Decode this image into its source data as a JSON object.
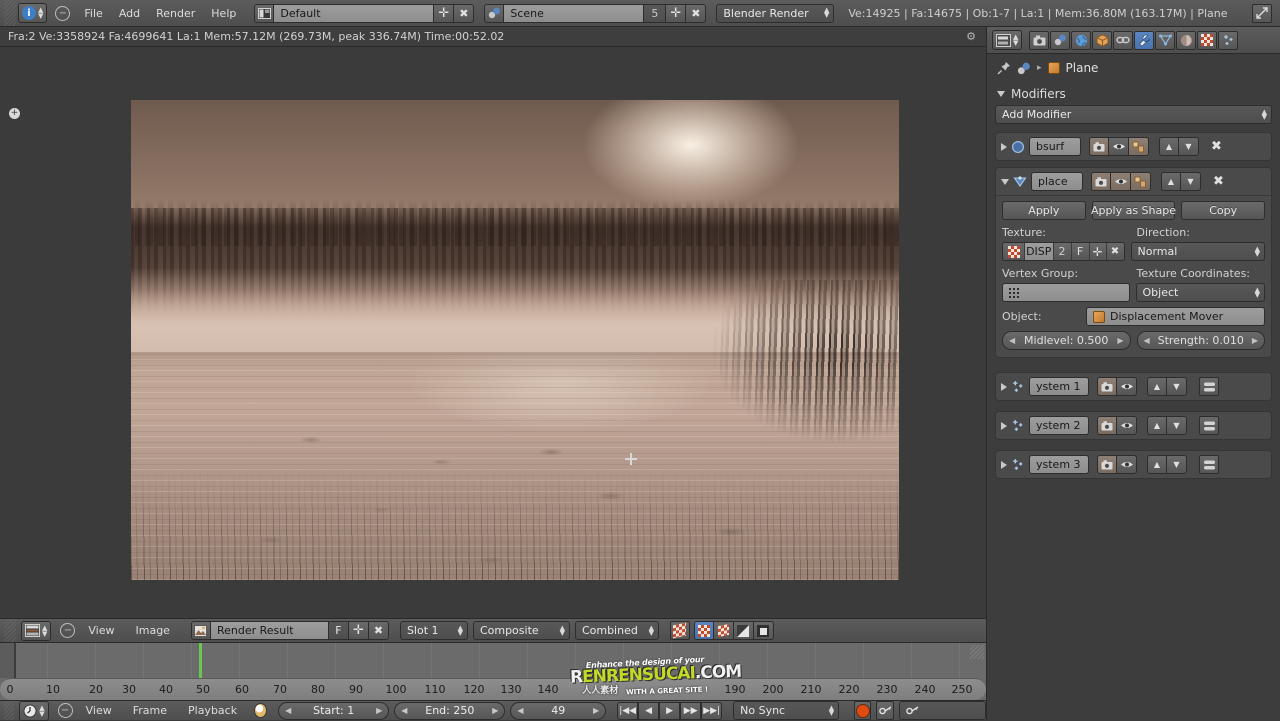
{
  "topbar": {
    "editor_icon": "info-editor-icon",
    "collapse_icon": "minus-icon",
    "menus": [
      "File",
      "Add",
      "Render",
      "Help"
    ],
    "screen_layout": {
      "icon": "screen-layout-icon",
      "value": "Default",
      "add": "+",
      "remove": "✕"
    },
    "scene": {
      "icon": "scene-icon",
      "value": "Scene",
      "users": "5",
      "add": "+",
      "remove": "✕"
    },
    "engine": "Blender Render",
    "stats": "Ve:14925 | Fa:14675 | Ob:1-7 | La:1 | Mem:36.80M (163.17M) | Plane",
    "maximize_icon": "maximize-icon"
  },
  "info_strip": {
    "text": "Fra:2  Ve:3358924 Fa:4699641 La:1 Mem:57.12M (269.73M, peak 336.74M) Time:00:52.02",
    "gear_icon": "gear-icon"
  },
  "image_editor": {
    "plus_icon": "add-region-icon",
    "render_alt": "Render Result — misty lake at sunrise",
    "cursor_icon": "3d-cursor-icon",
    "header": {
      "editor_icon": "image-editor-icon",
      "collapse_icon": "minus-icon",
      "menus": [
        "View",
        "Image"
      ],
      "image_icon": "image-datablock-icon",
      "image_name": "Render Result",
      "fake_user": "F",
      "add": "+",
      "remove": "✕",
      "slot": "Slot 1",
      "layer": "Composite",
      "pass": "Combined",
      "toggles": [
        "paint-icon",
        "alpha-checker-icon",
        "color-swatch-icon",
        "zdepth-icon",
        "alpha-only-icon"
      ]
    }
  },
  "timeline": {
    "playhead_frame": "49",
    "ticks": [
      "0",
      "10",
      "20",
      "30",
      "40",
      "50",
      "60",
      "70",
      "80",
      "90",
      "100",
      "110",
      "120",
      "130",
      "140",
      "190",
      "200",
      "210",
      "220",
      "230",
      "240",
      "250"
    ],
    "tick_positions": [
      10,
      53,
      96,
      129,
      166,
      203,
      242,
      280,
      318,
      356,
      396,
      435,
      474,
      511,
      548,
      735,
      773,
      811,
      849,
      887,
      925,
      962
    ]
  },
  "playbar": {
    "editor_icon": "timeline-editor-icon",
    "collapse_icon": "minus-icon",
    "menus": [
      "View",
      "Frame",
      "Playback"
    ],
    "clock_icon": "auto-keying-icon",
    "start": "Start: 1",
    "end": "End: 250",
    "current_frame": "49",
    "transport": [
      "jump-start-icon",
      "play-reverse-icon",
      "play-icon",
      "fast-forward-icon",
      "jump-end-icon"
    ],
    "sync": "No Sync",
    "record_icon": "record-icon",
    "key1_icon": "key-icon",
    "key2_icon": "key-icon"
  },
  "properties": {
    "tabs": [
      {
        "name": "render-tab",
        "icon": "camera-icon",
        "active": false
      },
      {
        "name": "scene-tab",
        "icon": "scene-icon",
        "active": false
      },
      {
        "name": "world-tab",
        "icon": "world-icon",
        "active": false
      },
      {
        "name": "object-tab",
        "icon": "cube-icon",
        "active": false
      },
      {
        "name": "constraints-tab",
        "icon": "chain-icon",
        "active": false
      },
      {
        "name": "modifiers-tab",
        "icon": "wrench-icon",
        "active": true
      },
      {
        "name": "data-tab",
        "icon": "triangle-mesh-icon",
        "active": false
      },
      {
        "name": "material-tab",
        "icon": "sphere-icon",
        "active": false
      },
      {
        "name": "texture-tab",
        "icon": "checker-icon",
        "active": false
      },
      {
        "name": "particles-tab",
        "icon": "particles-icon",
        "active": false
      }
    ],
    "breadcrumb": {
      "pin_icon": "pin-icon",
      "scene_icon": "scene-icon",
      "separator": "▸",
      "object_icon": "cube-icon",
      "object_name": "Plane"
    },
    "panel_title": "Modifiers",
    "add_modifier": "Add Modifier",
    "modifiers": [
      {
        "expand_icon": "triangle-right-icon",
        "type_icon": "subsurf-icon",
        "name": "bsurf",
        "expanded": false,
        "toggles": [
          "render-icon",
          "viewport-icon",
          "edit-mode-icon"
        ],
        "move_up": "▲",
        "move_down": "▼",
        "delete": "✕"
      },
      {
        "expand_icon": "triangle-down-icon",
        "type_icon": "displace-icon",
        "name": "place",
        "expanded": true,
        "toggles": [
          "render-icon",
          "viewport-icon",
          "edit-mode-icon"
        ],
        "move_up": "▲",
        "move_down": "▼",
        "delete": "✕",
        "body": {
          "apply": "Apply",
          "apply_as_shape": "Apply as Shape",
          "copy": "Copy",
          "texture_label": "Texture:",
          "texture_icon": "checker-icon",
          "texture_name": "DISP",
          "texture_users": "2",
          "texture_fake_user": "F",
          "texture_add": "+",
          "texture_remove": "✕",
          "direction_label": "Direction:",
          "direction_value": "Normal",
          "vertex_group_label": "Vertex Group:",
          "vertex_group_icon": "vertex-group-icon",
          "vertex_group_value": "",
          "texture_coordinates_label": "Texture Coordinates:",
          "texture_coordinates_value": "Object",
          "object_label": "Object:",
          "object_icon": "cube-icon",
          "object_value": "Displacement Mover",
          "midlevel": "Midlevel: 0.500",
          "strength": "Strength: 0.010"
        }
      },
      {
        "expand_icon": "triangle-right-icon",
        "type_icon": "particles-icon",
        "name": "ystem 1",
        "expanded": false,
        "toggles": [
          "render-icon",
          "viewport-icon"
        ],
        "move_up": "▲",
        "move_down": "▼",
        "extra_icon": "settings-icon"
      },
      {
        "expand_icon": "triangle-right-icon",
        "type_icon": "particles-icon",
        "name": "ystem 2",
        "expanded": false,
        "toggles": [
          "render-icon",
          "viewport-icon"
        ],
        "move_up": "▲",
        "move_down": "▼",
        "extra_icon": "settings-icon"
      },
      {
        "expand_icon": "triangle-right-icon",
        "type_icon": "particles-icon",
        "name": "ystem 3",
        "expanded": false,
        "toggles": [
          "render-icon",
          "viewport-icon"
        ],
        "move_up": "▲",
        "move_down": "▼",
        "extra_icon": "settings-icon"
      }
    ]
  },
  "watermark": {
    "line1": "Enhance the design of your",
    "line2a": "R",
    "line2b": "ENRENSUCAI",
    "line2c": ".COM",
    "line3": "WITH A GREAT SITE !",
    "line4": "人人素材"
  },
  "colors": {
    "accent_blue": "#4a73ad",
    "playhead_green": "#67c94d",
    "record_red": "#e04b12",
    "watermark_green": "#c3d92a"
  }
}
